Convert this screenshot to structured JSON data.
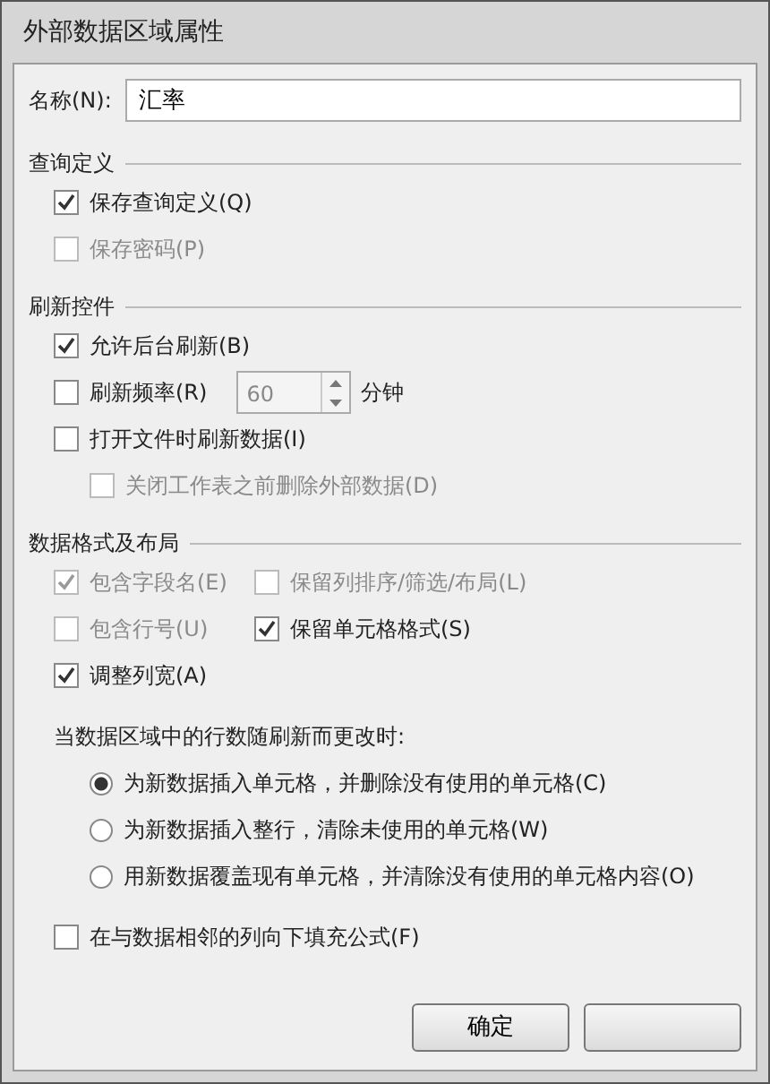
{
  "window": {
    "title": "外部数据区域属性"
  },
  "name_field": {
    "label": "名称(N):",
    "value": "汇率"
  },
  "sections": [
    {
      "title": "查询定义",
      "items": [
        {
          "kind": "checkbox",
          "label": "保存查询定义(Q)",
          "checked": true,
          "disabled": false
        },
        {
          "kind": "checkbox",
          "label": "保存密码(P)",
          "checked": false,
          "disabled": true
        }
      ]
    },
    {
      "title": "刷新控件",
      "items": [
        {
          "kind": "checkbox",
          "label": "允许后台刷新(B)",
          "checked": true,
          "disabled": false
        },
        {
          "kind": "spinner",
          "label": "刷新频率(R)",
          "checked": false,
          "disabled": false,
          "value": "60",
          "disabled_value": true,
          "unit": "分钟"
        },
        {
          "kind": "checkbox",
          "label": "打开文件时刷新数据(I)",
          "checked": false,
          "disabled": false,
          "children": [
            {
              "kind": "checkbox",
              "label": "关闭工作表之前删除外部数据(D)",
              "checked": false,
              "disabled": true
            }
          ]
        }
      ]
    },
    {
      "title": "数据格式及布局",
      "items": [
        {
          "kind": "pair",
          "items": [
            {
              "kind": "checkbox",
              "label": "包含字段名(E)",
              "checked": true,
              "disabled": true
            },
            {
              "kind": "checkbox",
              "label": "保留列排序/筛选/布局(L)",
              "checked": false,
              "disabled": true
            }
          ]
        },
        {
          "kind": "pair",
          "items": [
            {
              "kind": "checkbox",
              "label": "包含行号(U)",
              "checked": false,
              "disabled": true
            },
            {
              "kind": "checkbox",
              "label": "保留单元格格式(S)",
              "checked": true,
              "disabled": false
            }
          ]
        },
        {
          "kind": "checkbox",
          "label": "调整列宽(A)",
          "checked": true,
          "disabled": false
        },
        {
          "kind": "radios",
          "label": "当数据区域中的行数随刷新而更改时:",
          "options": [
            {
              "label": "为新数据插入单元格，并删除没有使用的单元格(C)",
              "selected": true
            },
            {
              "label": "为新数据插入整行，清除未使用的单元格(W)",
              "selected": false
            },
            {
              "label": "用新数据覆盖现有单元格，并清除没有使用的单元格内容(O)",
              "selected": false
            }
          ]
        },
        {
          "kind": "checkbox",
          "label": "在与数据相邻的列向下填充公式(F)",
          "checked": false,
          "disabled": false
        }
      ]
    }
  ],
  "buttons": [
    {
      "kind": "button",
      "label": "确定"
    },
    {
      "kind": "button"
    }
  ]
}
